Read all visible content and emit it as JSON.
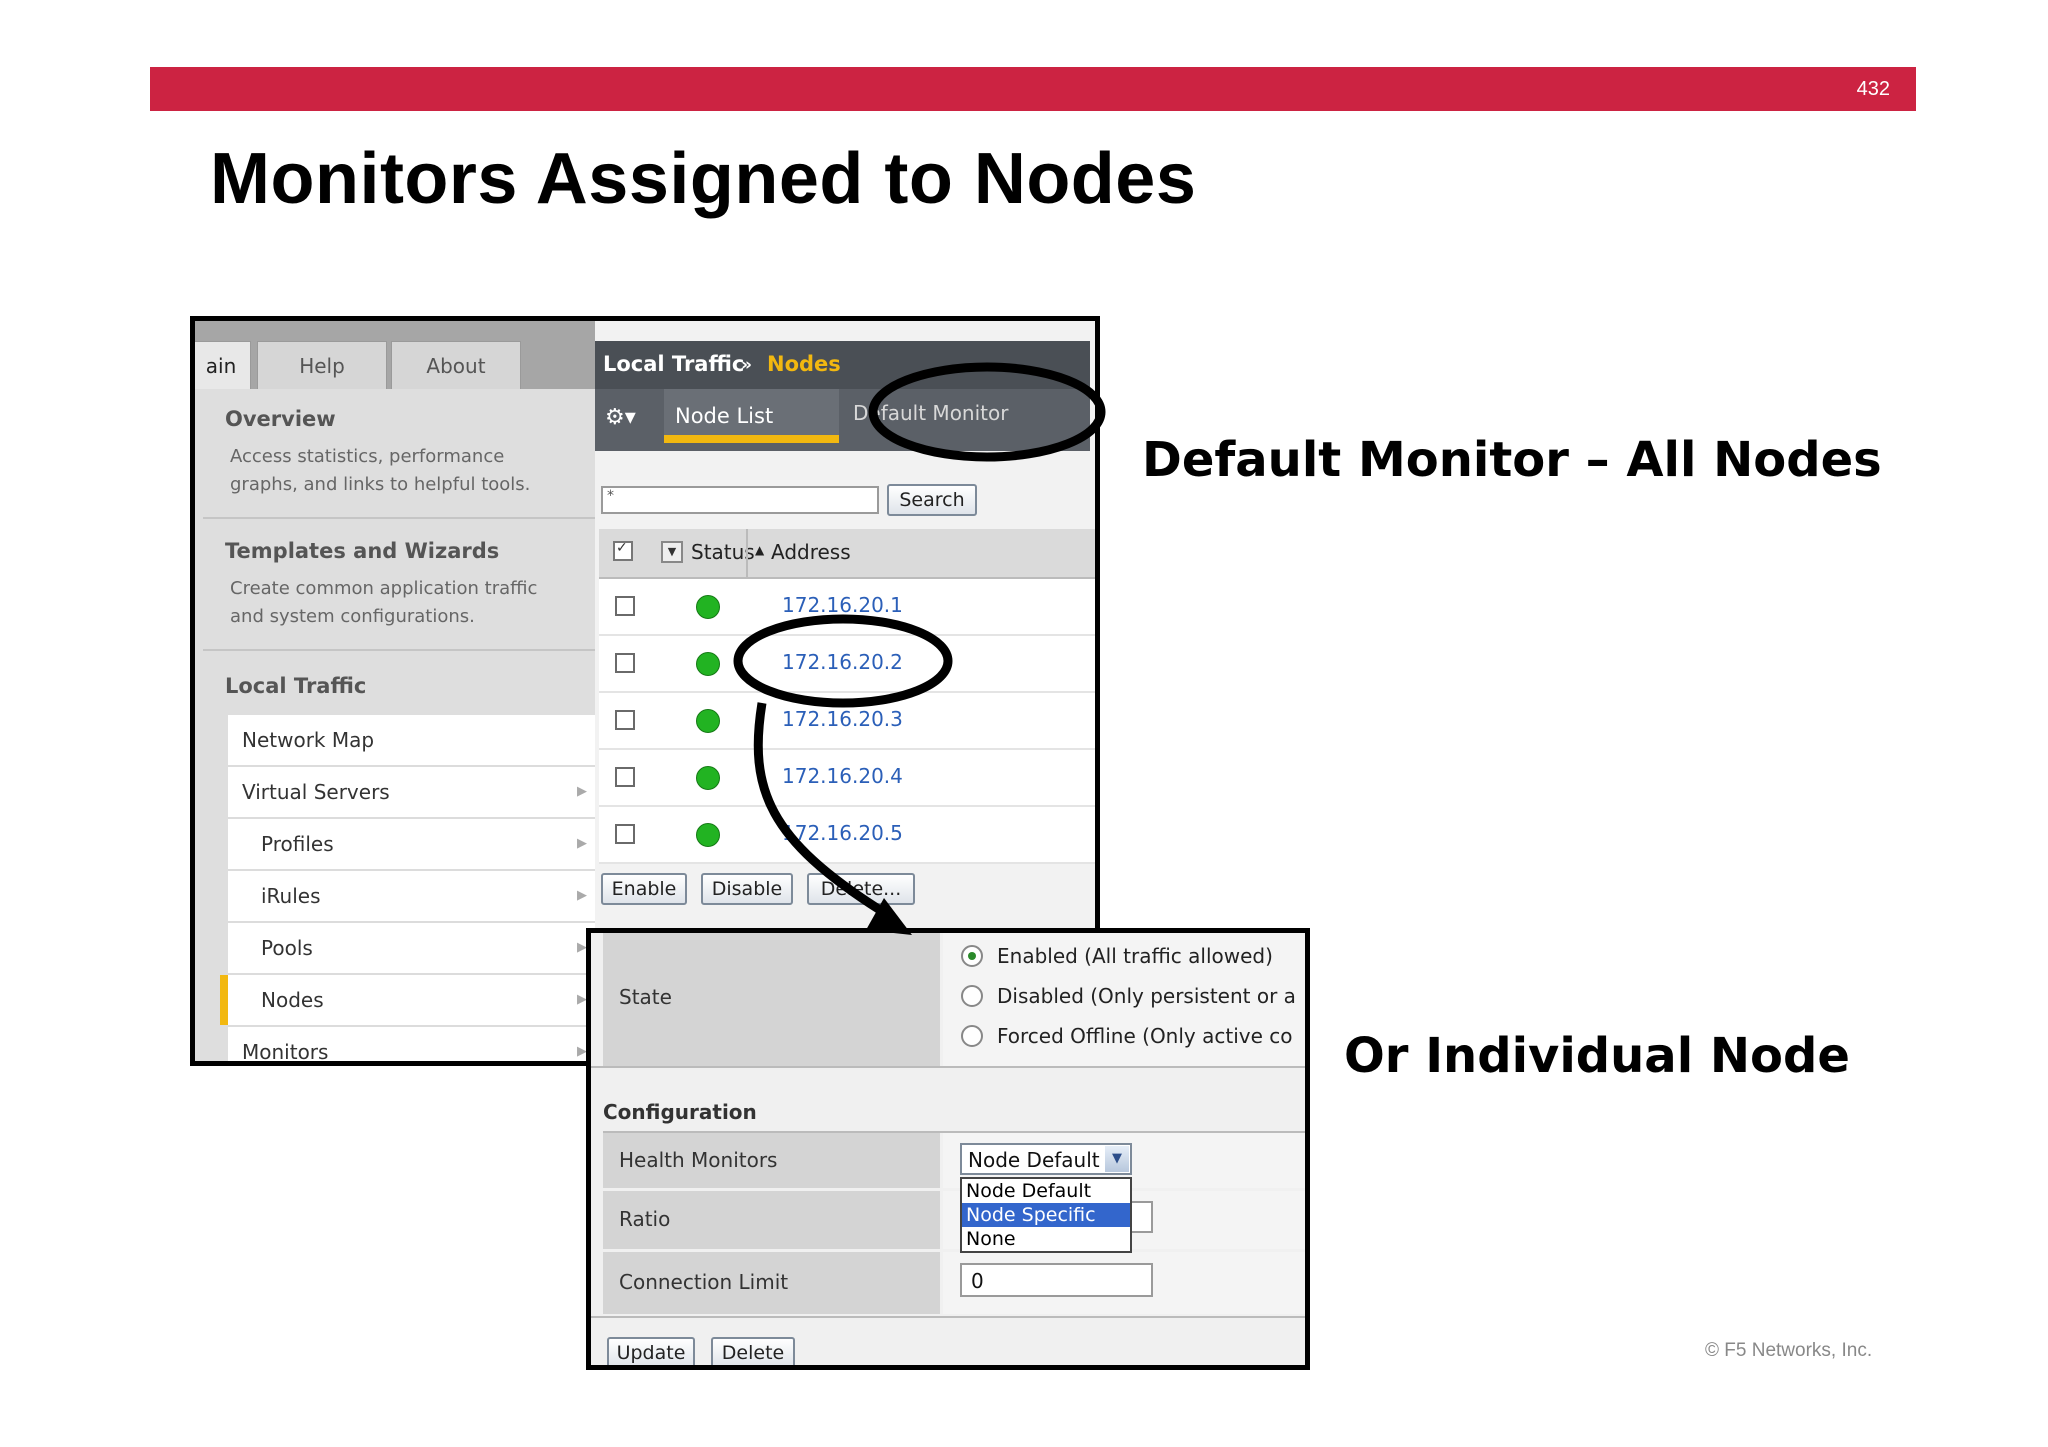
{
  "slide": {
    "page_number": "432",
    "title": "Monitors Assigned to Nodes",
    "callout_default": "Default Monitor – All Nodes",
    "callout_individual": "Or Individual  Node",
    "copyright": "© F5 Networks, Inc.",
    "banner_color": "#cc2342"
  },
  "screenshot1": {
    "tabs": [
      "ain",
      "Help",
      "About"
    ],
    "panels": [
      {
        "title": "Overview",
        "desc": "Access statistics, performance graphs, and links to helpful tools."
      },
      {
        "title": "Templates and Wizards",
        "desc": "Create common application traffic and system configurations."
      }
    ],
    "local_traffic_title": "Local Traffic",
    "nav_items": [
      "Network Map",
      "Virtual Servers",
      "Profiles",
      "iRules",
      "Pools",
      "Nodes",
      "Monitors"
    ],
    "breadcrumb": {
      "section": "Local Traffic",
      "sep": "»",
      "page": "Nodes"
    },
    "subtabs": {
      "node_list": "Node List",
      "default_monitor": "Default Monitor"
    },
    "filter_value": "*",
    "search_label": "Search",
    "columns": {
      "status": "Status",
      "address": "Address"
    },
    "rows": [
      {
        "address": "172.16.20.1",
        "status": "green"
      },
      {
        "address": "172.16.20.2",
        "status": "green"
      },
      {
        "address": "172.16.20.3",
        "status": "green"
      },
      {
        "address": "172.16.20.4",
        "status": "green"
      },
      {
        "address": "172.16.20.5",
        "status": "green"
      }
    ],
    "buttons": {
      "enable": "Enable",
      "disable": "Disable",
      "delete": "Delete..."
    }
  },
  "screenshot2": {
    "state_label": "State",
    "state_options": [
      {
        "label": "Enabled (All traffic allowed)",
        "selected": true
      },
      {
        "label": "Disabled (Only persistent or a",
        "selected": false
      },
      {
        "label": "Forced Offline (Only active co",
        "selected": false
      }
    ],
    "configuration_label": "Configuration",
    "health_monitors_label": "Health Monitors",
    "health_monitor_value": "Node Default",
    "health_monitor_options": [
      "Node Default",
      "Node Specific",
      "None"
    ],
    "highlighted_option": "Node Specific",
    "ratio_label": "Ratio",
    "connection_limit_label": "Connection Limit",
    "connection_limit_value": "0",
    "buttons": {
      "update": "Update",
      "delete": "Delete"
    }
  }
}
